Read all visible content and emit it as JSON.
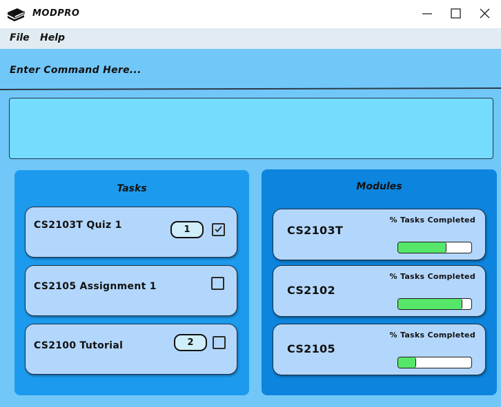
{
  "window": {
    "title": "MODPRO",
    "icons": {
      "app": "books-icon",
      "minimize": "minimize-icon",
      "maximize": "maximize-icon",
      "close": "close-icon"
    }
  },
  "menu": {
    "items": [
      "File",
      "Help"
    ]
  },
  "command": {
    "placeholder": "Enter Command Here...",
    "value": ""
  },
  "result": {
    "text": ""
  },
  "tasks": {
    "title": "Tasks",
    "items": [
      {
        "name": "CS2103T Quiz 1",
        "badge": "1",
        "checked": true
      },
      {
        "name": "CS2105 Assignment 1",
        "badge": null,
        "checked": false
      },
      {
        "name": "CS2100 Tutorial",
        "badge": "2",
        "checked": false
      }
    ]
  },
  "modules": {
    "title": "Modules",
    "items": [
      {
        "code": "CS2103T",
        "progress_label": "% Tasks Completed",
        "progress": 0.65
      },
      {
        "code": "CS2102",
        "progress_label": "% Tasks  Completed",
        "progress": 0.87
      },
      {
        "code": "CS2105",
        "progress_label": "% Tasks  Completed",
        "progress": 0.24
      }
    ]
  },
  "colors": {
    "background": "#72c7f9",
    "tasks_panel": "#1c9bee",
    "modules_panel": "#0d84dd",
    "card": "#b3d7fc",
    "progress_fill": "#56e76a",
    "result_box": "#75dcfe"
  }
}
